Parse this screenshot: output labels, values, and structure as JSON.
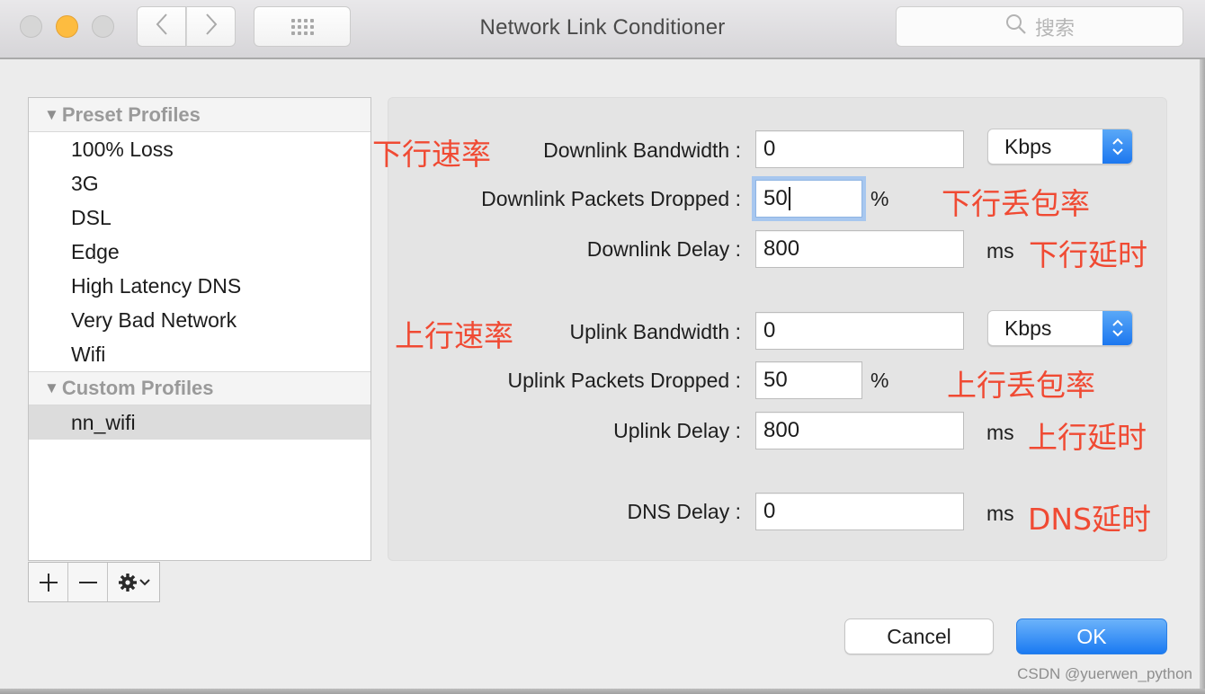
{
  "window": {
    "title": "Network Link Conditioner",
    "search_placeholder": "搜索"
  },
  "toolbar": {
    "back_icon": "chevron-left-icon",
    "forward_icon": "chevron-right-icon",
    "grid_icon": "grid-icon"
  },
  "sidebar": {
    "groups": [
      {
        "label": "Preset Profiles",
        "items": [
          "100% Loss",
          "3G",
          "DSL",
          "Edge",
          "High Latency DNS",
          "Very Bad Network",
          "Wifi"
        ]
      },
      {
        "label": "Custom Profiles",
        "items": [
          "nn_wifi"
        ],
        "selected": "nn_wifi"
      }
    ],
    "tools": {
      "add": "+",
      "remove": "−"
    }
  },
  "settings": {
    "downlink_bandwidth": {
      "label": "Downlink Bandwidth :",
      "value": "0",
      "unit": "Kbps"
    },
    "downlink_dropped": {
      "label": "Downlink Packets Dropped :",
      "value": "50",
      "unit": "%"
    },
    "downlink_delay": {
      "label": "Downlink Delay :",
      "value": "800",
      "unit": "ms"
    },
    "uplink_bandwidth": {
      "label": "Uplink Bandwidth :",
      "value": "0",
      "unit": "Kbps"
    },
    "uplink_dropped": {
      "label": "Uplink Packets Dropped :",
      "value": "50",
      "unit": "%"
    },
    "uplink_delay": {
      "label": "Uplink Delay :",
      "value": "800",
      "unit": "ms"
    },
    "dns_delay": {
      "label": "DNS Delay :",
      "value": "0",
      "unit": "ms"
    }
  },
  "annotations": {
    "downlink_rate": "下行速率",
    "downlink_loss": "下行丢包率",
    "downlink_delay": "下行延时",
    "uplink_rate": "上行速率",
    "uplink_loss": "上行丢包率",
    "uplink_delay": "上行延时",
    "dns_delay": "DNS延时",
    "color": "#f04a33"
  },
  "buttons": {
    "cancel": "Cancel",
    "ok": "OK"
  },
  "watermark": "CSDN @yuerwen_python"
}
